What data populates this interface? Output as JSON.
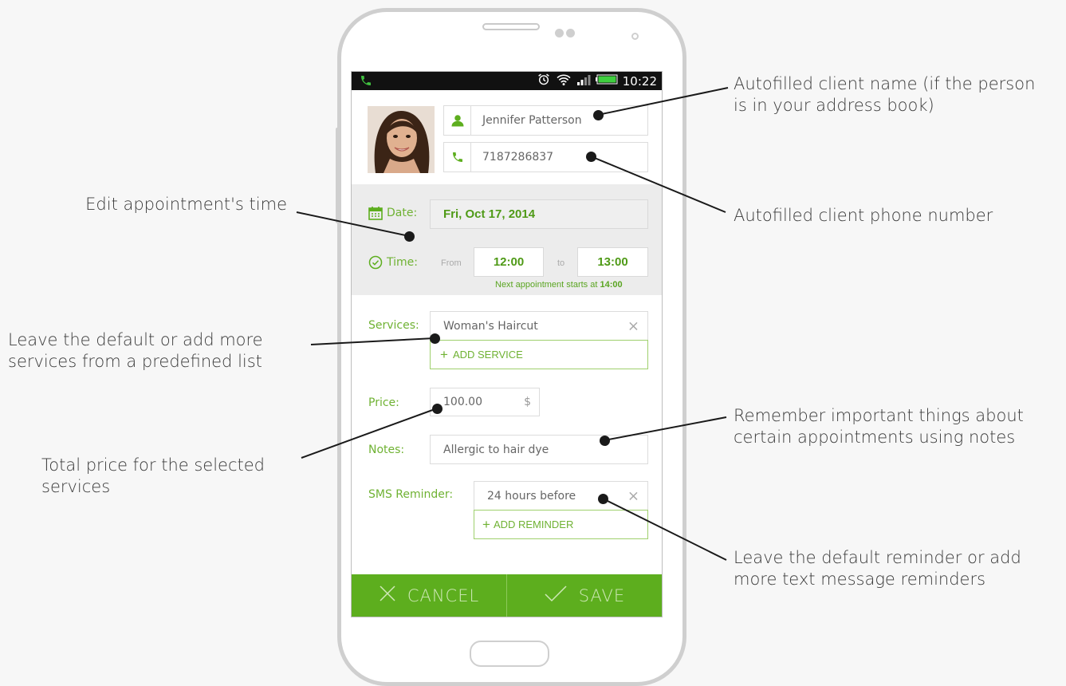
{
  "statusbar": {
    "time": "10:22"
  },
  "contact": {
    "name": "Jennifer Patterson",
    "phone": "7187286837"
  },
  "date": {
    "label": "Date:",
    "value": "Fri, Oct 17, 2014"
  },
  "time": {
    "label": "Time:",
    "from_label": "From",
    "from": "12:00",
    "to_label": "to",
    "to": "13:00",
    "hint_prefix": "Next appointment starts at",
    "hint_time": "14:00"
  },
  "services": {
    "label": "Services:",
    "value": "Woman's Haircut",
    "add_label": "ADD SERVICE"
  },
  "price": {
    "label": "Price:",
    "value": "100.00",
    "currency": "$"
  },
  "notes": {
    "label": "Notes:",
    "value": "Allergic to hair dye"
  },
  "sms": {
    "label": "SMS Reminder:",
    "value": "24 hours before",
    "add_label": "ADD REMINDER"
  },
  "actions": {
    "cancel": "CANCEL",
    "save": "SAVE"
  },
  "annotations": {
    "client_name": [
      "Autofilled client name (if the person",
      "is in your address book)"
    ],
    "client_phone": [
      "Autofilled client phone number"
    ],
    "edit_time": [
      "Edit appointment's time"
    ],
    "services": [
      "Leave the default or add more",
      "services from a predefined list"
    ],
    "notes": [
      "Remember important things about",
      "certain appointments using notes"
    ],
    "price": [
      "Total price for the selected",
      "services"
    ],
    "reminder": [
      "Leave the default reminder or add",
      "more text message reminders"
    ]
  },
  "colors": {
    "accent": "#5dae1e",
    "label_green": "#6fb233",
    "background": "#f7f7f7"
  }
}
